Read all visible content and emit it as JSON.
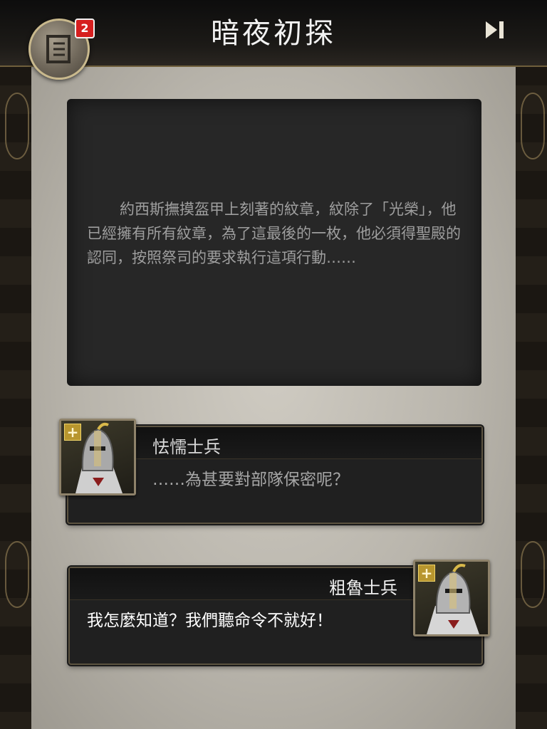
{
  "header": {
    "title": "暗夜初探",
    "menu_icon": "document-icon",
    "badge_count": "2",
    "skip_icon": "skip-forward-icon"
  },
  "narration": {
    "text": "約西斯撫摸盔甲上刻著的紋章，紋除了「光榮」，他已經擁有所有紋章，為了這最後的一枚，他必須得聖殿的認同，按照祭司的要求執行這項行動……"
  },
  "dialogue": [
    {
      "speaker": "怯懦士兵",
      "line": "……為甚要對部隊保密呢？",
      "portrait_icon": "knight-portrait-icon"
    },
    {
      "speaker": "粗魯士兵",
      "line": "我怎麼知道？我們聽命令不就好！",
      "portrait_icon": "knight-portrait-icon"
    }
  ],
  "colors": {
    "badge": "#d61f1f",
    "frame_gold": "#8a7548",
    "parchment": "#bdb9b0",
    "dialog_bg": "#202020"
  }
}
